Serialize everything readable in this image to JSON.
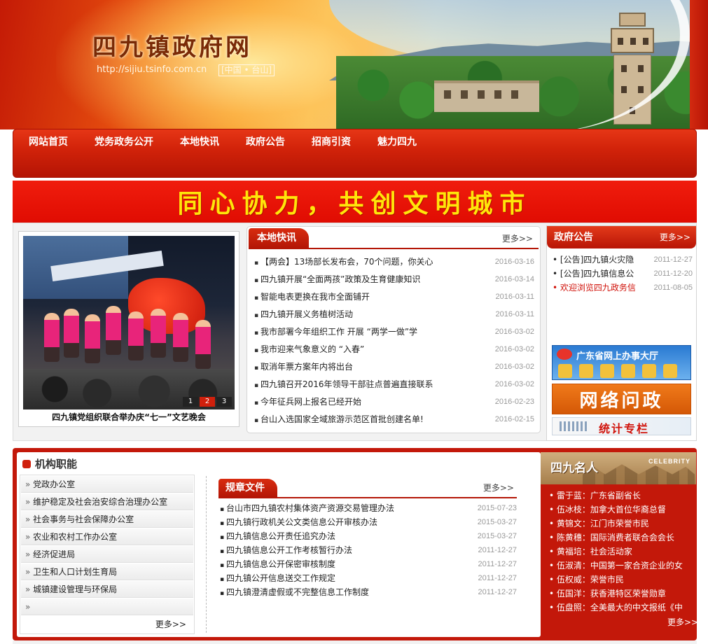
{
  "header": {
    "site_title": "四九镇政府网",
    "url": "http://sijiu.tsinfo.com.cn",
    "region": "[中国 • 台山]"
  },
  "nav": {
    "items": [
      {
        "label": "网站首页"
      },
      {
        "label": "党务政务公开"
      },
      {
        "label": "本地快讯"
      },
      {
        "label": "政府公告"
      },
      {
        "label": "招商引资"
      },
      {
        "label": "魅力四九"
      }
    ]
  },
  "banner": {
    "slogan": "同心协力，共创文明城市"
  },
  "photo": {
    "caption": "四九镇党组织联合举办庆“七一”文艺晚会",
    "pages": [
      "1",
      "2",
      "3"
    ],
    "active_page": "2"
  },
  "local_news": {
    "title": "本地快讯",
    "more": "更多>>",
    "items": [
      {
        "title": "【两会】13场部长发布会，70个问题，你关心",
        "date": "2016-03-16"
      },
      {
        "title": "四九镇开展“全面两孩”政策及生育健康知识",
        "date": "2016-03-14"
      },
      {
        "title": "智能电表更换在我市全面铺开",
        "date": "2016-03-11"
      },
      {
        "title": "四九镇开展义务植树活动",
        "date": "2016-03-11"
      },
      {
        "title": "我市部署今年组织工作 开展 “两学一做”学",
        "date": "2016-03-02"
      },
      {
        "title": "我市迎来气象意义的 “入春”",
        "date": "2016-03-02"
      },
      {
        "title": "取消年票方案年内将出台",
        "date": "2016-03-02"
      },
      {
        "title": "四九镇召开2016年领导干部驻点普遍直接联系",
        "date": "2016-03-02"
      },
      {
        "title": "今年征兵网上报名已经开始",
        "date": "2016-02-23"
      },
      {
        "title": "台山入选国家全域旅游示范区首批创建名单!",
        "date": "2016-02-15"
      }
    ]
  },
  "gov_notice": {
    "title": "政府公告",
    "more": "更多>>",
    "items": [
      {
        "title": "[公告]四九镇火灾隐",
        "date": "2011-12-27"
      },
      {
        "title": "[公告]四九镇信息公",
        "date": "2011-12-20"
      },
      {
        "title": "欢迎浏览四九政务信",
        "date": "2011-08-05",
        "highlight": true
      }
    ]
  },
  "ads": {
    "online_hall": "广东省网上办事大厅",
    "net_politics": "网络问政",
    "statistics": "统计专栏"
  },
  "org": {
    "title": "机构职能",
    "items": [
      "党政办公室",
      "维护稳定及社会治安综合治理办公室",
      "社会事务与社会保障办公室",
      "农业和农村工作办公室",
      "经济促进局",
      "卫生和人口计划生育局",
      "城镇建设管理与环保局",
      ""
    ],
    "more": "更多>>"
  },
  "rules": {
    "title": "规章文件",
    "more": "更多>>",
    "items": [
      {
        "title": "台山市四九镇农村集体资产资源交易管理办法",
        "date": "2015-07-23"
      },
      {
        "title": "四九镇行政机关公文类信息公开审核办法",
        "date": "2015-03-27"
      },
      {
        "title": "四九镇信息公开责任追究办法",
        "date": "2015-03-27"
      },
      {
        "title": "四九镇信息公开工作考核暂行办法",
        "date": "2011-12-27"
      },
      {
        "title": "四九镇信息公开保密审核制度",
        "date": "2011-12-27"
      },
      {
        "title": "四九镇公开信息送交工作规定",
        "date": "2011-12-27"
      },
      {
        "title": "四九镇澄清虚假或不完整信息工作制度",
        "date": "2011-12-27"
      }
    ]
  },
  "celebrities": {
    "title": "四九名人",
    "subtitle": "CELEBRITY",
    "items": [
      "雷于蓝：广东省副省长",
      "伍冰枝：加拿大首位华裔总督",
      "黄锦文：江门市荣誉市民",
      "陈黄穗：国际消费者联合会会长",
      "黄福培：社会活动家",
      "伍淑清：中国第一家合资企业的女",
      "伍权威：荣誉市民",
      "伍国洋：获香港特区荣誉勋章",
      "伍盘照：全美最大的中文报纸《中"
    ],
    "more": "更多>>"
  }
}
